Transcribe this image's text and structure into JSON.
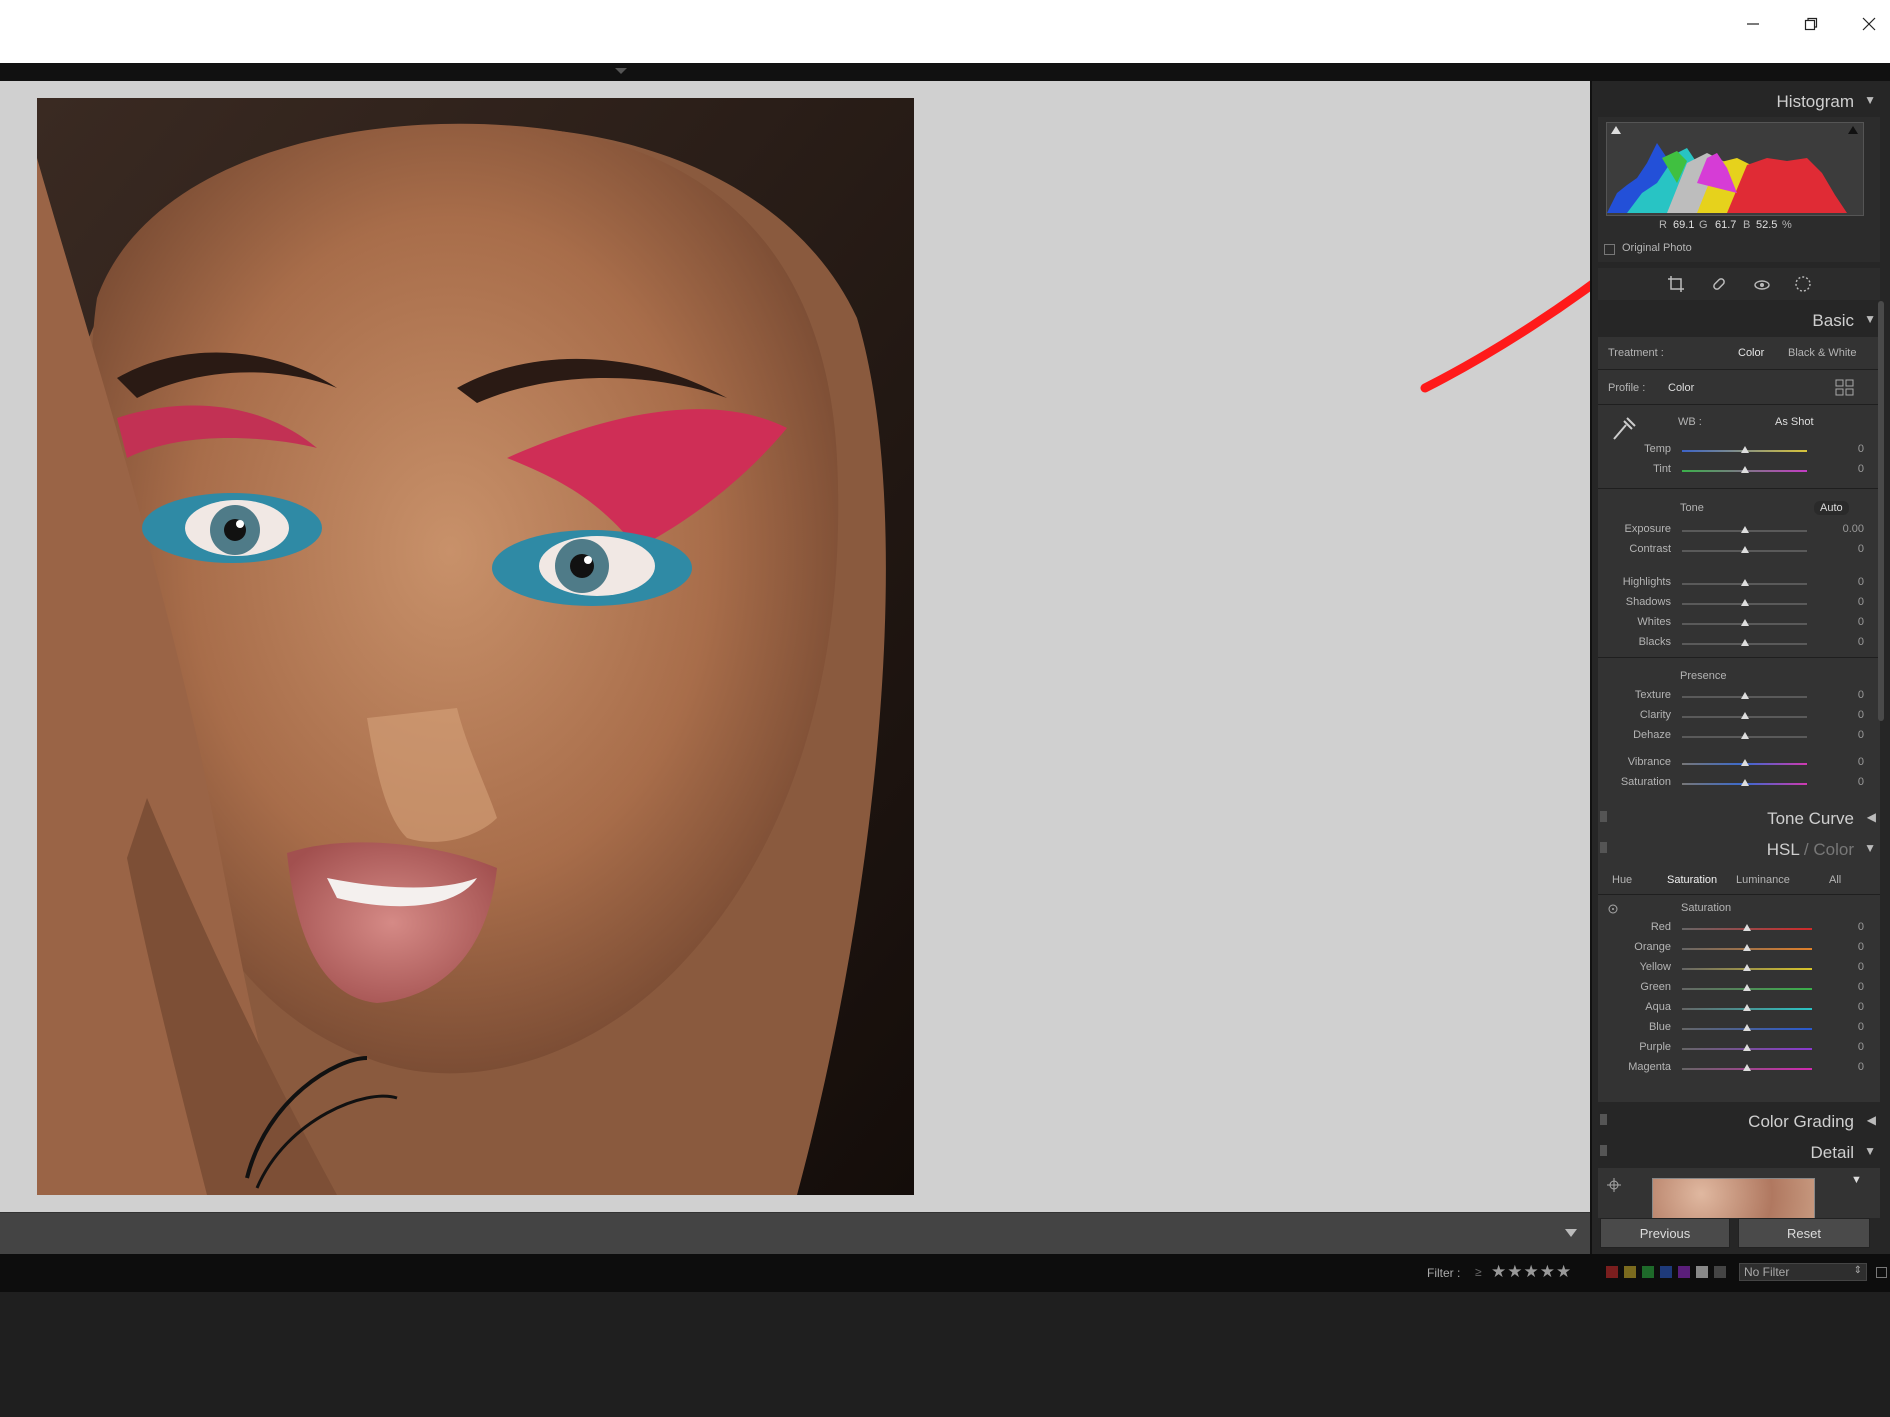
{
  "colors": {
    "accent_red": "#ff1a1a",
    "panel_bg": "#262626",
    "canvas_bg": "#d0d0d0"
  },
  "window": {
    "minimize_icon": "minimize-icon",
    "maximize_icon": "restore-icon",
    "close_icon": "close-icon"
  },
  "histogram": {
    "title": "Histogram",
    "r_label": "R",
    "r_value": "69.1",
    "g_label": "G",
    "g_value": "61.7",
    "b_label": "B",
    "b_value": "52.5",
    "pct": "%",
    "original_photo_label": "Original Photo"
  },
  "basic": {
    "title": "Basic",
    "treatment_label": "Treatment :",
    "treatment_color": "Color",
    "treatment_bw": "Black & White",
    "profile_label": "Profile :",
    "profile_value": "Color",
    "wb_label": "WB :",
    "wb_value": "As Shot",
    "temp_label": "Temp",
    "temp_value": "0",
    "tint_label": "Tint",
    "tint_value": "0",
    "tone_label": "Tone",
    "auto_label": "Auto",
    "exposure_label": "Exposure",
    "exposure_value": "0.00",
    "contrast_label": "Contrast",
    "contrast_value": "0",
    "highlights_label": "Highlights",
    "highlights_value": "0",
    "shadows_label": "Shadows",
    "shadows_value": "0",
    "whites_label": "Whites",
    "whites_value": "0",
    "blacks_label": "Blacks",
    "blacks_value": "0",
    "presence_label": "Presence",
    "texture_label": "Texture",
    "texture_value": "0",
    "clarity_label": "Clarity",
    "clarity_value": "0",
    "dehaze_label": "Dehaze",
    "dehaze_value": "0",
    "vibrance_label": "Vibrance",
    "vibrance_value": "0",
    "saturation_label": "Saturation",
    "saturation_value": "0"
  },
  "tone_curve": {
    "title": "Tone Curve"
  },
  "hsl": {
    "title_hsl": "HSL",
    "title_sep": " / ",
    "title_color": "Color",
    "tabs": {
      "hue": "Hue",
      "saturation": "Saturation",
      "luminance": "Luminance",
      "all": "All"
    },
    "section_label": "Saturation",
    "red_label": "Red",
    "red_value": "0",
    "orange_label": "Orange",
    "orange_value": "0",
    "yellow_label": "Yellow",
    "yellow_value": "0",
    "green_label": "Green",
    "green_value": "0",
    "aqua_label": "Aqua",
    "aqua_value": "0",
    "blue_label": "Blue",
    "blue_value": "0",
    "purple_label": "Purple",
    "purple_value": "0",
    "magenta_label": "Magenta",
    "magenta_value": "0"
  },
  "color_grading": {
    "title": "Color Grading"
  },
  "detail": {
    "title": "Detail"
  },
  "buttons": {
    "previous": "Previous",
    "reset": "Reset"
  },
  "filter": {
    "label": "Filter :",
    "gte": "≥",
    "stars": "★★★★★",
    "no_filter": "No Filter"
  }
}
